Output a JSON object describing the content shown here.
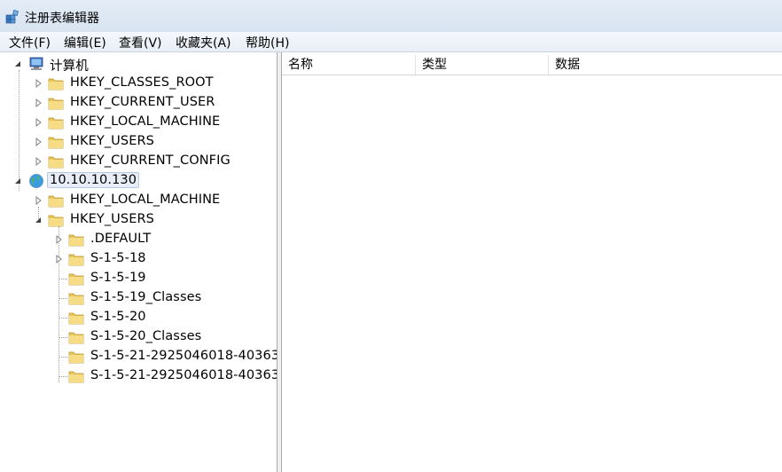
{
  "window": {
    "title": "注册表编辑器",
    "icon": "regedit-icon"
  },
  "menu": [
    "文件(F)",
    "编辑(E)",
    "查看(V)",
    "收藏夹(A)",
    "帮助(H)"
  ],
  "tree": {
    "computer": "计算机",
    "local_hives": [
      "HKEY_CLASSES_ROOT",
      "HKEY_CURRENT_USER",
      "HKEY_LOCAL_MACHINE",
      "HKEY_USERS",
      "HKEY_CURRENT_CONFIG"
    ],
    "remote": "10.10.10.130",
    "remote_hives": [
      "HKEY_LOCAL_MACHINE",
      "HKEY_USERS"
    ],
    "users_subkeys": [
      ".DEFAULT",
      "S-1-5-18",
      "S-1-5-19",
      "S-1-5-19_Classes",
      "S-1-5-20",
      "S-1-5-20_Classes",
      "S-1-5-21-2925046018-40363",
      "S-1-5-21-2925046018-40363"
    ]
  },
  "list": {
    "columns": [
      "名称",
      "类型",
      "数据"
    ]
  }
}
